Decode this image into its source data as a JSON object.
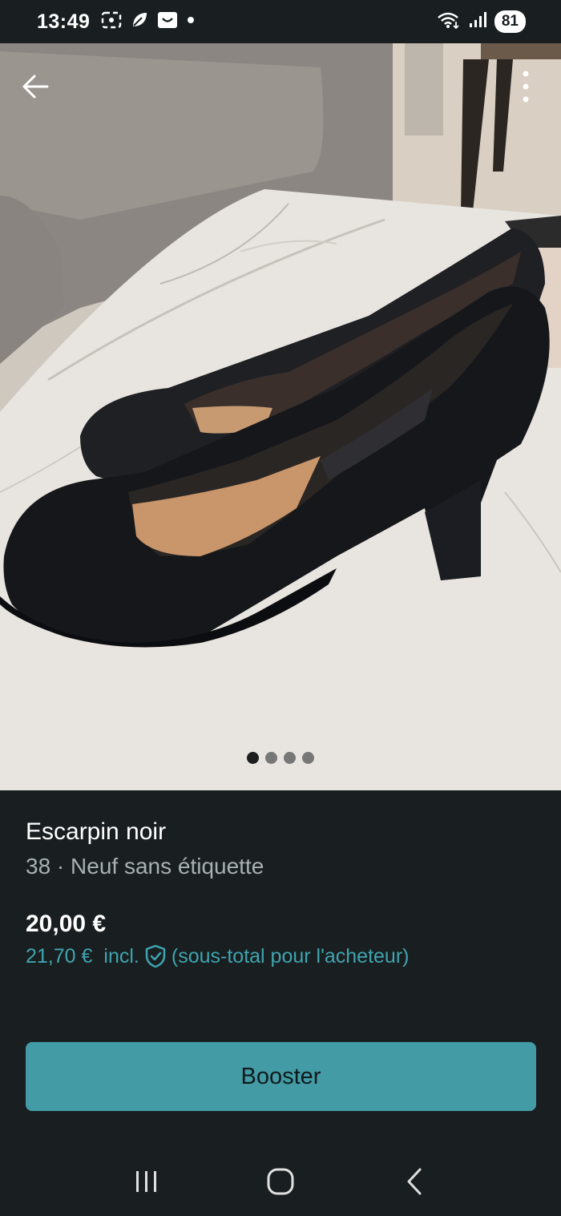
{
  "status_bar": {
    "time": "13:49",
    "battery": "81",
    "icons_left": [
      "screenshot-icon",
      "leaf-icon",
      "gallery-icon",
      "notification-dot-icon"
    ],
    "icons_right": [
      "wifi-icon",
      "signal-icon"
    ]
  },
  "photo": {
    "icons": {
      "back": "arrow-left-icon",
      "menu": "more-vertical-icon"
    },
    "carousel": {
      "count": 4,
      "active_index": 0
    }
  },
  "item": {
    "title": "Escarpin noir",
    "subtitle": "38 · Neuf sans étiquette",
    "price": "20,00 €",
    "price_total": "21,70 €",
    "incl": "incl.",
    "buyer_note": "(sous-total pour l'acheteur)"
  },
  "actions": {
    "booster_label": "Booster"
  },
  "nav": {
    "icons": [
      "recent-apps-icon",
      "home-icon",
      "back-icon"
    ]
  },
  "colors": {
    "background": "#191f20",
    "accent": "#439ba5",
    "accent_text": "#3fa4b0",
    "muted_text": "#a8b0b1"
  }
}
